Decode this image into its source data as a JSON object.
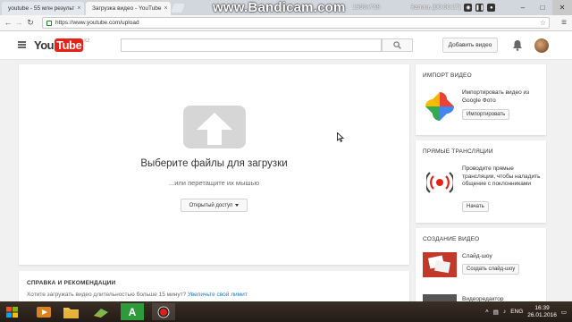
{
  "browser": {
    "tabs": [
      {
        "title": "youtube - 55 млн результ",
        "active": false,
        "favicon_color": "#4285f4"
      },
      {
        "title": "Загрузка видео - YouTube",
        "active": true,
        "favicon_color": "#e62117"
      }
    ],
    "url": "https://www.youtube.com/upload",
    "window_controls": {
      "minimize": "–",
      "maximize": "□",
      "close": "✕"
    }
  },
  "overlay": {
    "brand": "www.Bandicam.com",
    "resolution": "1366x768",
    "recording": "Запись [00:00:27]"
  },
  "header": {
    "logo_you": "You",
    "logo_tube": "Tube",
    "logo_region": "KZ",
    "search_placeholder": "",
    "upload_button": "Добавить видео"
  },
  "upload": {
    "title": "Выберите файлы для загрузки",
    "subtitle": "...или перетащите их мышью",
    "privacy": "Открытый доступ"
  },
  "help": {
    "title": "СПРАВКА И РЕКОМЕНДАЦИИ",
    "text": "Хотите загружать видео длительностью больше 15 минут? ",
    "link": "Увеличьте свой лимит"
  },
  "sidebar": {
    "import": {
      "title": "ИМПОРТ ВИДЕО",
      "description": "Импортировать видео из Google Фото",
      "button": "Импортировать"
    },
    "live": {
      "title": "ПРЯМЫЕ ТРАНСЛЯЦИИ",
      "description": "Проводите прямые трансляции, чтобы наладить общение с поклонниками",
      "button": "Начать"
    },
    "create": {
      "title": "СОЗДАНИЕ ВИДЕО",
      "slideshow_label": "Слайд-шоу",
      "slideshow_button": "Создать слайд-шоу",
      "editor_label": "Видеоредактор"
    }
  },
  "taskbar": {
    "language": "ENG",
    "time": "16:39",
    "date": "26.01.2016"
  }
}
